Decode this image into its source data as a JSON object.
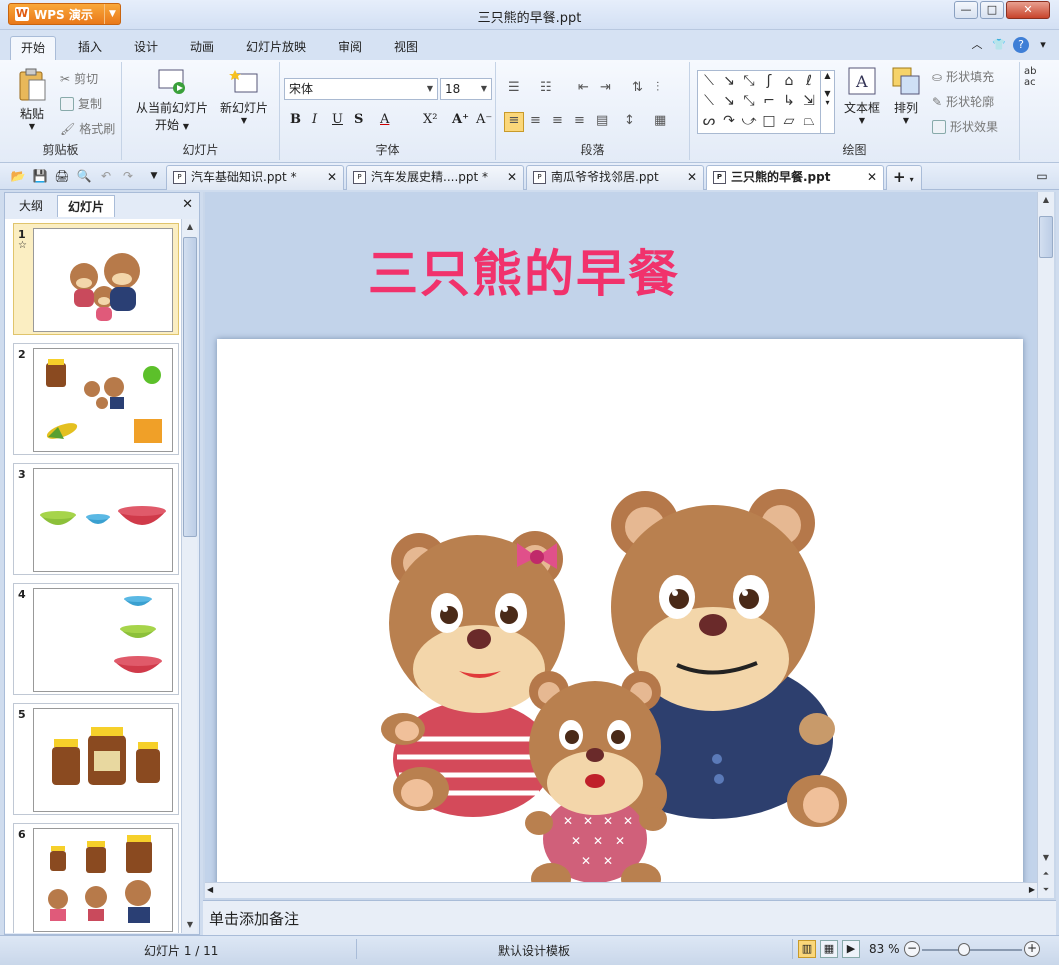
{
  "app": {
    "menu_button": "WPS 演示",
    "window_title": "三只熊的早餐.ppt"
  },
  "ribbon_tabs": [
    "开始",
    "插入",
    "设计",
    "动画",
    "幻灯片放映",
    "审阅",
    "视图"
  ],
  "ribbon": {
    "clipboard": {
      "paste": "粘贴",
      "cut": "剪切",
      "copy": "复制",
      "format_painter": "格式刷",
      "label": "剪贴板"
    },
    "slides": {
      "from_current": "从当前幻灯片",
      "start": "开始",
      "new_slide": "新幻灯片",
      "label": "幻灯片"
    },
    "font": {
      "family": "宋体",
      "size": "18",
      "label": "字体"
    },
    "paragraph": {
      "label": "段落"
    },
    "drawing": {
      "textbox": "文本框",
      "arrange": "排列",
      "shape_fill": "形状填充",
      "shape_outline": "形状轮廓",
      "shape_effect": "形状效果",
      "label": "绘图"
    }
  },
  "doc_tabs": [
    {
      "label": "汽车基础知识.ppt *"
    },
    {
      "label": "汽车发展史精....ppt *"
    },
    {
      "label": "南瓜爷爷找邻居.ppt"
    },
    {
      "label": "三只熊的早餐.ppt"
    }
  ],
  "left_panel": {
    "tabs": [
      "大纲",
      "幻灯片"
    ],
    "slides": [
      "1",
      "2",
      "3",
      "4",
      "5",
      "6"
    ]
  },
  "slide": {
    "title": "三只熊的早餐"
  },
  "notes_placeholder": "单击添加备注",
  "status": {
    "slide_indicator": "幻灯片 1 / 11",
    "template": "默认设计模板",
    "zoom": "83 %"
  },
  "colors": {
    "title_pink": "#f1326c",
    "wps_orange": "#e9781a",
    "ui_blue": "#c9d7ea"
  }
}
